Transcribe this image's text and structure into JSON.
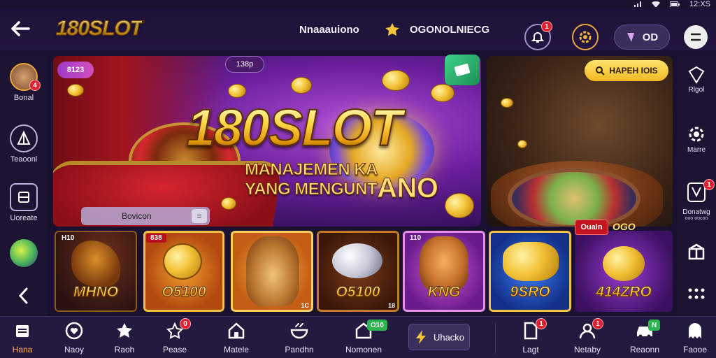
{
  "status_bar": {
    "time": "12:XS"
  },
  "header": {
    "logo_text": "180SLOT",
    "link_1": "Nnaaauiono",
    "link_2": "OGONOLNIECG",
    "notification_badge": "1",
    "wallet_label": "OD",
    "colors": {
      "background": "#231540",
      "accent_gold": "#ffd23a"
    }
  },
  "left_sidebar": {
    "items": [
      {
        "label": "Bonal",
        "badge": "4"
      },
      {
        "label": "Teaoonl"
      },
      {
        "label": "Uoreate"
      }
    ]
  },
  "hero": {
    "tag_left": "8123",
    "tag_pill": "138p",
    "title": "180SLOT",
    "subtitle_line1": "MANAJEMEN KA",
    "subtitle_line2": "YANG MENGUNT",
    "subtitle_big": "ANO",
    "search_placeholder": "Bovicon",
    "search_button": "="
  },
  "side_banner": {
    "button_label": "HAPEH IOIS"
  },
  "right_sidebar": {
    "items": [
      {
        "label": "Rlgol"
      },
      {
        "label": "Marre"
      },
      {
        "label": "Donatwg",
        "sublabel": "ooo oocoo",
        "badge": "1"
      },
      {
        "label": ""
      }
    ]
  },
  "game_cards": [
    {
      "tag": "H10",
      "label": "MHNO",
      "small": ""
    },
    {
      "tag": "838",
      "label": "O5100",
      "small": ""
    },
    {
      "tag": "",
      "label": "",
      "small": "1C"
    },
    {
      "tag": "",
      "label": "O5100",
      "small": "18"
    },
    {
      "tag": "110",
      "label": "KNG",
      "small": ""
    },
    {
      "tag": "",
      "label": "9SRO",
      "small": ""
    },
    {
      "tag": "",
      "label": "414ZRO",
      "small": ""
    }
  ],
  "cards_extra": {
    "tag": "Oualn",
    "text": "OGO"
  },
  "bottom_nav": {
    "items": [
      {
        "label": "Hana",
        "active": true
      },
      {
        "label": "Naoy"
      },
      {
        "label": "Raoh"
      },
      {
        "label": "Pease",
        "badge": "0"
      },
      {
        "label": "Matele"
      },
      {
        "label": "Pandhn"
      },
      {
        "label": "Nomonen",
        "green_badge": "O10"
      },
      {
        "label": "Lagt",
        "badge": "1"
      },
      {
        "label": "Netaby",
        "badge": "1"
      },
      {
        "label": "Reaonn",
        "green_badge": "N"
      },
      {
        "label": "Faooe"
      }
    ],
    "center_button": "Uhacko"
  }
}
